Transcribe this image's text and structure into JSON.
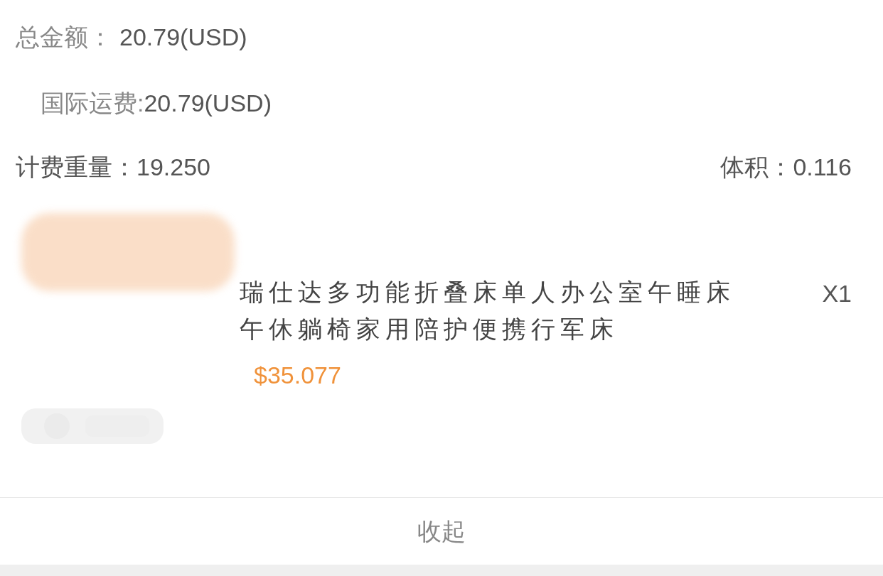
{
  "summary": {
    "total_label": "总金额：",
    "total_value": "20.79(USD)",
    "shipping_label": "国际运费:",
    "shipping_value": "20.79(USD)",
    "weight_label": "计费重量：",
    "weight_value": "19.250",
    "volume_label": "体积：",
    "volume_value": "0.116"
  },
  "items": [
    {
      "kind": "picture",
      "title": "瑞仕达多功能折叠床单人办公室午睡床午休躺椅家用陪护便携行军床",
      "quantity": "X1",
      "price": "$35.077"
    }
  ],
  "collapse_button": "收起"
}
